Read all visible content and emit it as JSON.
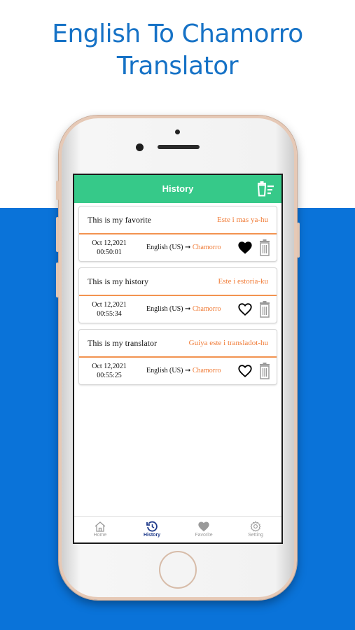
{
  "promo": {
    "title_line1": "English To Chamorro",
    "title_line2": "Translator"
  },
  "colors": {
    "header_green": "#36c989",
    "accent_orange": "#f07a35",
    "band_blue": "#0a73d9",
    "title_blue": "#1672c6"
  },
  "header": {
    "title": "History",
    "clear_icon": "clear-all-icon"
  },
  "history": [
    {
      "source": "This is my favorite",
      "translation": "Este i mas ya-hu",
      "date": "Oct 12,2021",
      "time": "00:50:01",
      "from_lang": "English (US)",
      "arrow": "➞",
      "to_lang": "Chamorro",
      "favorite": true
    },
    {
      "source": "This is my history",
      "translation": "Este i estoria-ku",
      "date": "Oct 12,2021",
      "time": "00:55:34",
      "from_lang": "English (US)",
      "arrow": "➞",
      "to_lang": "Chamorro",
      "favorite": false
    },
    {
      "source": "This is my translator",
      "translation": "Guiya este i transladot-hu",
      "date": "Oct 12,2021",
      "time": "00:55:25",
      "from_lang": "English (US)",
      "arrow": "➞",
      "to_lang": "Chamorro",
      "favorite": false
    }
  ],
  "tabs": [
    {
      "label": "Home",
      "icon": "home-icon",
      "active": false
    },
    {
      "label": "History",
      "icon": "history-icon",
      "active": true
    },
    {
      "label": "Favorite",
      "icon": "heart-icon",
      "active": false
    },
    {
      "label": "Setting",
      "icon": "gear-icon",
      "active": false
    }
  ]
}
